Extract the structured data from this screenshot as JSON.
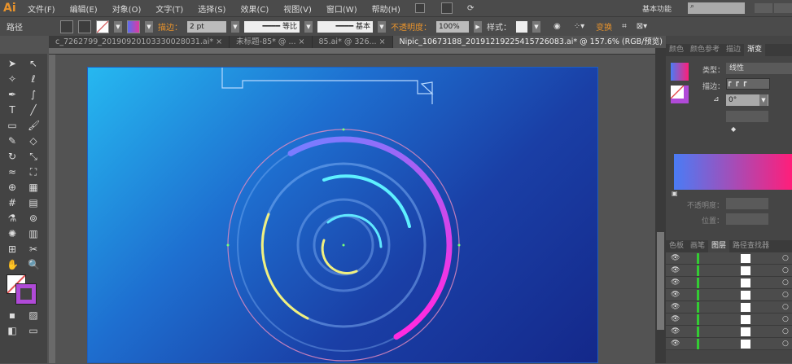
{
  "app": {
    "logo": "Ai"
  },
  "menu": [
    "文件(F)",
    "编辑(E)",
    "对象(O)",
    "文字(T)",
    "选择(S)",
    "效果(C)",
    "视图(V)",
    "窗口(W)",
    "帮助(H)"
  ],
  "workspace": "基本功能",
  "control": {
    "object_type": "路径",
    "stroke_label": "描边：",
    "stroke_value": "2 pt",
    "profile_label": "等比",
    "brush_label": "基本",
    "opacity_label": "不透明度：",
    "opacity_value": "100%",
    "style_label": "样式：",
    "transform_label": "变换"
  },
  "tabs": [
    {
      "label": "c_7262799_20190920103330028031.ai* ×"
    },
    {
      "label": "未标题-85* @ ... ×"
    },
    {
      "label": "85.ai* @ 326... ×"
    },
    {
      "label": "Nipic_10673188_20191219225415726083.ai* @ 157.6% (RGB/预览)  ×"
    }
  ],
  "tabs_overflow": ">>",
  "panel": {
    "tabs": [
      "颜色",
      "颜色参考",
      "描边",
      "渐变"
    ],
    "type_label": "类型：",
    "type_value": "线性",
    "stroke_label": "描边：",
    "angle_value": "0°",
    "opacity_label": "不透明度：",
    "position_label": "位置：",
    "gradient": {
      "start": "#4a7cf5",
      "end": "#ff1e7a"
    },
    "bottom_tabs": [
      "色板",
      "画笔",
      "图层",
      "路径查找器"
    ],
    "layer_count": 8
  },
  "colors": {
    "accent": "#e8932c",
    "artboard_start": "#26b8f0",
    "artboard_end": "#14288a"
  }
}
